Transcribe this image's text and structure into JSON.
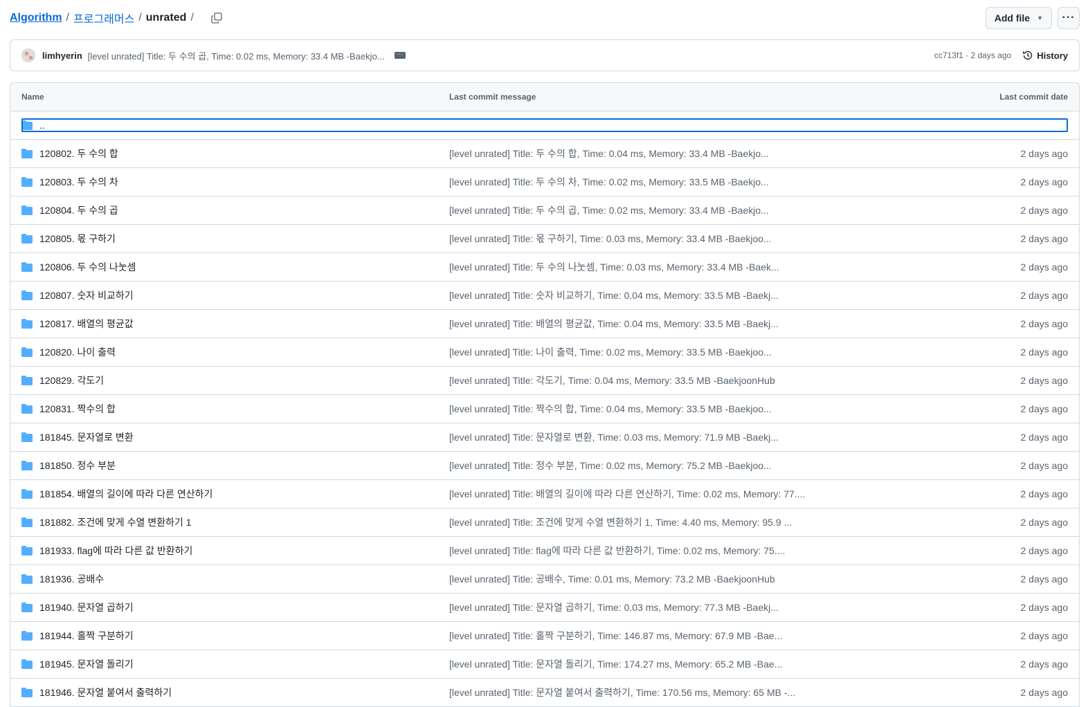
{
  "breadcrumb": {
    "root": "Algorithm",
    "folder": "프로그래머스",
    "current": "unrated",
    "trailing_sep": "/"
  },
  "actions": {
    "add_file": "Add file",
    "more": "···"
  },
  "commit": {
    "author": "limhyerin",
    "message": "[level unrated] Title: 두 수의 곱, Time: 0.02 ms, Memory: 33.4 MB -Baekjo...",
    "hash_date": "cc713f1 · 2 days ago",
    "history": "History"
  },
  "table": {
    "headers": {
      "name": "Name",
      "message": "Last commit message",
      "date": "Last commit date"
    },
    "parent": "..",
    "rows": [
      {
        "name": "120802. 두 수의 합",
        "message": "[level unrated] Title: 두 수의 합, Time: 0.04 ms, Memory: 33.4 MB -Baekjo...",
        "date": "2 days ago"
      },
      {
        "name": "120803. 두 수의 차",
        "message": "[level unrated] Title: 두 수의 차, Time: 0.02 ms, Memory: 33.5 MB -Baekjo...",
        "date": "2 days ago"
      },
      {
        "name": "120804. 두 수의 곱",
        "message": "[level unrated] Title: 두 수의 곱, Time: 0.02 ms, Memory: 33.4 MB -Baekjo...",
        "date": "2 days ago"
      },
      {
        "name": "120805. 몫 구하기",
        "message": "[level unrated] Title: 몫 구하기, Time: 0.03 ms, Memory: 33.4 MB -Baekjoo...",
        "date": "2 days ago"
      },
      {
        "name": "120806. 두 수의 나눗셈",
        "message": "[level unrated] Title: 두 수의 나눗셈, Time: 0.03 ms, Memory: 33.4 MB -Baek...",
        "date": "2 days ago"
      },
      {
        "name": "120807. 숫자 비교하기",
        "message": "[level unrated] Title: 숫자 비교하기, Time: 0.04 ms, Memory: 33.5 MB -Baekj...",
        "date": "2 days ago"
      },
      {
        "name": "120817. 배열의 평균값",
        "message": "[level unrated] Title: 배열의 평균값, Time: 0.04 ms, Memory: 33.5 MB -Baekj...",
        "date": "2 days ago"
      },
      {
        "name": "120820. 나이 출력",
        "message": "[level unrated] Title: 나이 출력, Time: 0.02 ms, Memory: 33.5 MB -Baekjoo...",
        "date": "2 days ago"
      },
      {
        "name": "120829. 각도기",
        "message": "[level unrated] Title: 각도기, Time: 0.04 ms, Memory: 33.5 MB -BaekjoonHub",
        "date": "2 days ago"
      },
      {
        "name": "120831. 짝수의 합",
        "message": "[level unrated] Title: 짝수의 합, Time: 0.04 ms, Memory: 33.5 MB -Baekjoo...",
        "date": "2 days ago"
      },
      {
        "name": "181845. 문자열로 변환",
        "message": "[level unrated] Title: 문자열로 변환, Time: 0.03 ms, Memory: 71.9 MB -Baekj...",
        "date": "2 days ago"
      },
      {
        "name": "181850. 정수 부분",
        "message": "[level unrated] Title: 정수 부분, Time: 0.02 ms, Memory: 75.2 MB -Baekjoo...",
        "date": "2 days ago"
      },
      {
        "name": "181854. 배열의 길이에 따라 다른 연산하기",
        "message": "[level unrated] Title: 배열의 길이에 따라 다른 연산하기, Time: 0.02 ms, Memory: 77....",
        "date": "2 days ago"
      },
      {
        "name": "181882. 조건에 맞게 수열 변환하기 1",
        "message": "[level unrated] Title: 조건에 맞게 수열 변환하기 1, Time: 4.40 ms, Memory: 95.9 ...",
        "date": "2 days ago"
      },
      {
        "name": "181933. flag에 따라 다른 값 반환하기",
        "message": "[level unrated] Title: flag에 따라 다른 값 반환하기, Time: 0.02 ms, Memory: 75....",
        "date": "2 days ago"
      },
      {
        "name": "181936. 공배수",
        "message": "[level unrated] Title: 공배수, Time: 0.01 ms, Memory: 73.2 MB -BaekjoonHub",
        "date": "2 days ago"
      },
      {
        "name": "181940. 문자열 곱하기",
        "message": "[level unrated] Title: 문자열 곱하기, Time: 0.03 ms, Memory: 77.3 MB -Baekj...",
        "date": "2 days ago"
      },
      {
        "name": "181944. 홀짝 구분하기",
        "message": "[level unrated] Title: 홀짝 구분하기, Time: 146.87 ms, Memory: 67.9 MB -Bae...",
        "date": "2 days ago"
      },
      {
        "name": "181945. 문자열 돌리기",
        "message": "[level unrated] Title: 문자열 돌리기, Time: 174.27 ms, Memory: 65.2 MB -Bae...",
        "date": "2 days ago"
      },
      {
        "name": "181946. 문자열 붙여서 출력하기",
        "message": "[level unrated] Title: 문자열 붙여서 출력하기, Time: 170.56 ms, Memory: 65 MB -...",
        "date": "2 days ago"
      }
    ]
  },
  "icons": {
    "folder": "folder-icon",
    "copy": "copy-icon",
    "history": "history-icon"
  },
  "colors": {
    "folder": "#54aeff",
    "link": "#0969da",
    "focus": "#0969da"
  }
}
